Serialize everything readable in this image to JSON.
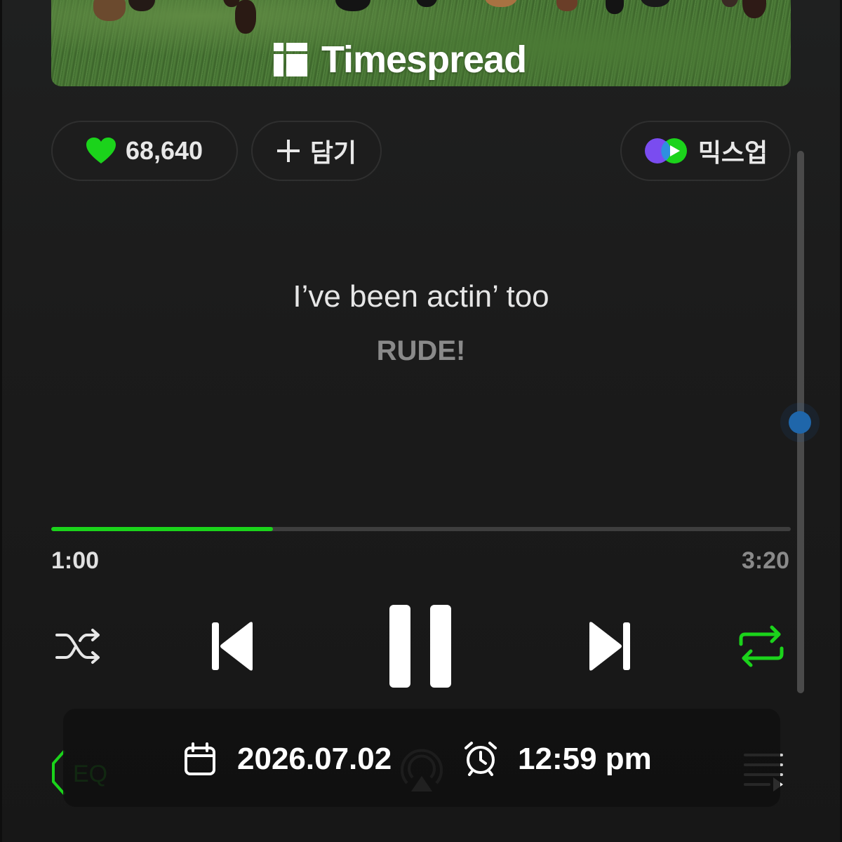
{
  "album": {
    "brand_name": "Timespread"
  },
  "actions": {
    "like_count": "68,640",
    "add_label": "담기",
    "mixup_label": "믹스업"
  },
  "lyrics": {
    "current_line": "I’ve been actin’ too",
    "next_line": "RUDE!"
  },
  "playback": {
    "elapsed": "1:00",
    "duration": "3:20",
    "progress_fraction": 0.3,
    "repeat_on": true,
    "state": "playing"
  },
  "overlay": {
    "date": "2026.07.02",
    "time": "12:59 pm"
  },
  "bottom": {
    "eq_label": "EQ"
  },
  "icons": {
    "like": "heart-icon",
    "add": "plus-icon",
    "mixup": "mixup-icon",
    "shuffle": "shuffle-icon",
    "prev": "skip-previous-icon",
    "pause": "pause-icon",
    "next": "skip-next-icon",
    "repeat": "repeat-icon",
    "date": "calendar-icon",
    "time": "alarm-clock-icon",
    "eq": "eq-speaker-icon",
    "airplay": "airplay-icon",
    "playlist": "playlist-icon"
  },
  "colors": {
    "accent": "#1bd31b",
    "background": "#1b1b1b",
    "scroll_thumb": "#1f66aa"
  }
}
